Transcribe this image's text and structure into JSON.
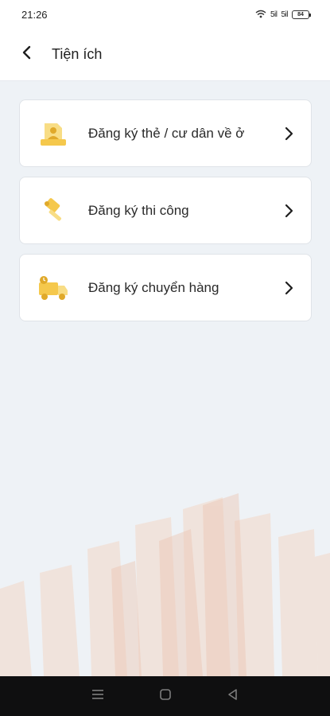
{
  "status_bar": {
    "time": "21:26",
    "signal_1": "5il",
    "signal_2": "5il",
    "battery": "84"
  },
  "header": {
    "title": "Tiện ích",
    "back_icon": "chevron-left-icon"
  },
  "menu": {
    "items": [
      {
        "label": "Đăng ký thẻ / cư dân về ở",
        "icon": "resident-card-icon"
      },
      {
        "label": "Đăng ký thi công",
        "icon": "construction-hammer-icon"
      },
      {
        "label": "Đăng ký chuyển hàng",
        "icon": "delivery-truck-icon"
      }
    ]
  },
  "colors": {
    "accent_yellow": "#f5c84c",
    "background": "#eef2f6",
    "card_bg": "#ffffff",
    "nav_bg": "#0f0f10"
  }
}
